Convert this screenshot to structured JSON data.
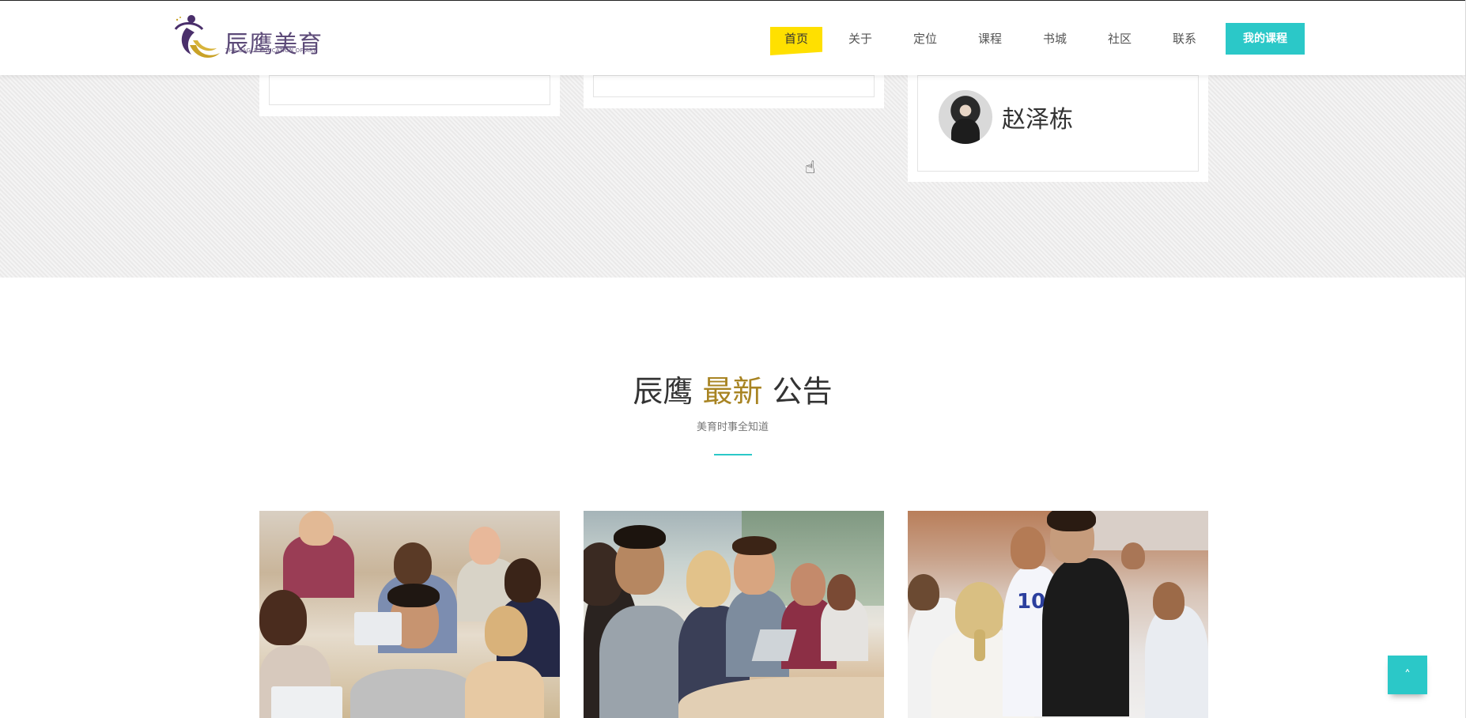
{
  "header": {
    "logo": {
      "cn": "辰鹰美育",
      "en": "THE EAGLE EDUCATION OF ART"
    },
    "nav": [
      {
        "label": "首页",
        "active": true
      },
      {
        "label": "关于"
      },
      {
        "label": "定位"
      },
      {
        "label": "课程"
      },
      {
        "label": "书城"
      },
      {
        "label": "社区"
      },
      {
        "label": "联系"
      }
    ],
    "my_course": "我的课程"
  },
  "testimonials": {
    "author_name": "赵泽栋"
  },
  "announcements": {
    "title_prefix": "辰鹰",
    "title_highlight": "最新",
    "title_suffix": "公告",
    "subtitle": "美育时事全知道",
    "accent_color": "#2bc8c8",
    "highlight_color": "#a88423"
  },
  "back_to_top": {
    "icon": "chevron-up-icon",
    "glyph": "˄"
  }
}
